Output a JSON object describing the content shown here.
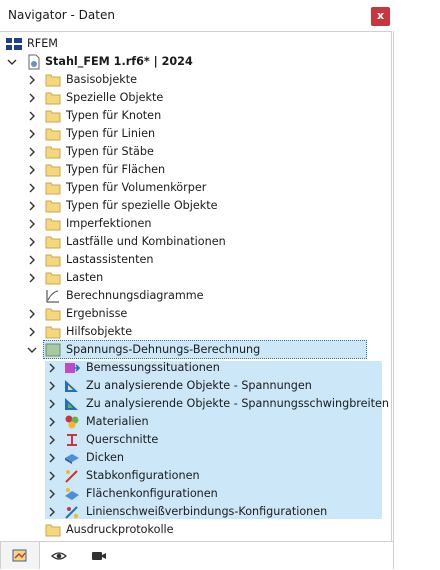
{
  "window": {
    "title": "Navigator - Daten",
    "close_glyph": "x"
  },
  "tree": {
    "root": "RFEM",
    "file": "Stahl_FEM 1.rf6* | 2024",
    "items": [
      "Basisobjekte",
      "Spezielle Objekte",
      "Typen für Knoten",
      "Typen für Linien",
      "Typen für Stäbe",
      "Typen für Flächen",
      "Typen für Volumenkörper",
      "Typen für spezielle Objekte",
      "Imperfektionen",
      "Lastfälle und Kombinationen",
      "Lastassistenten",
      "Lasten",
      "Berechnungsdiagramme",
      "Ergebnisse",
      "Hilfsobjekte"
    ],
    "addon": "Spannungs-Dehnungs-Berechnung",
    "addon_items": [
      "Bemessungssituationen",
      "Zu analysierende Objekte - Spannungen",
      "Zu analysierende Objekte - Spannungsschwingbreiten",
      "Materialien",
      "Querschnitte",
      "Dicken",
      "Stabkonfigurationen",
      "Flächenkonfigurationen",
      "Linienschweißverbindungs-Konfigurationen"
    ],
    "last": "Ausdruckprotokolle"
  },
  "tabs": [
    "data-tab-icon",
    "view-tab-icon",
    "camera-tab-icon"
  ],
  "colors": {
    "selection": "#cce8f8",
    "close": "#c8353e",
    "folder": "#f5d77e"
  }
}
